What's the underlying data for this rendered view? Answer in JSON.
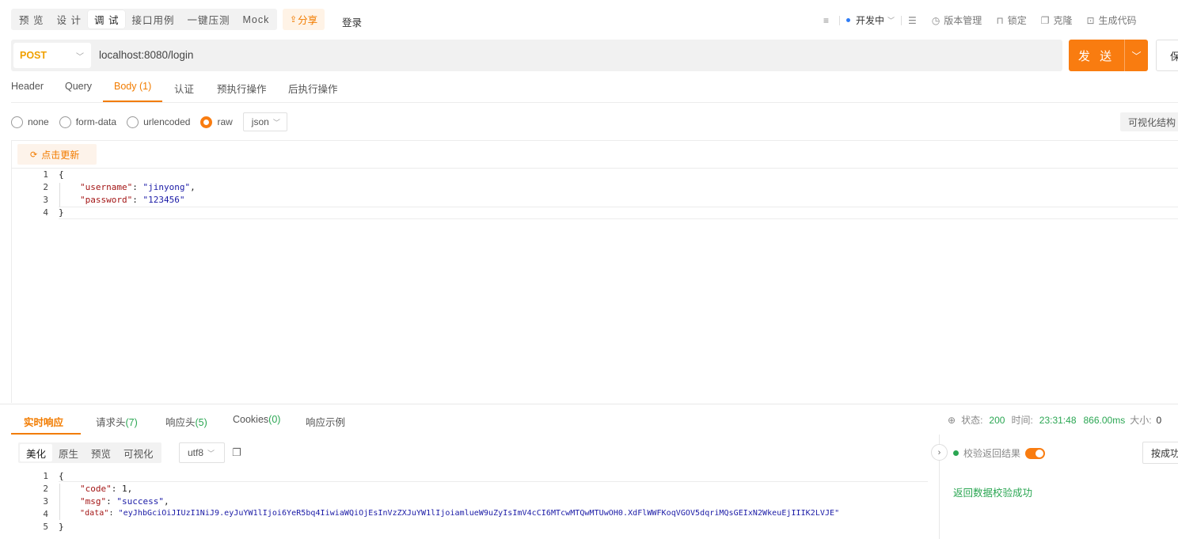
{
  "top": {
    "modes": [
      "预 览",
      "设 计",
      "调 试",
      "接口用例",
      "一键压测",
      "Mock"
    ],
    "active_mode": "调 试",
    "share": "分享",
    "login": "登录",
    "env": "开发中",
    "version": "版本管理",
    "lock": "锁定",
    "clone": "克隆",
    "gencode": "生成代码"
  },
  "request": {
    "method": "POST",
    "url": "localhost:8080/login",
    "send": "发 送",
    "save": "保"
  },
  "req_tabs": [
    {
      "label": "Header",
      "count": ""
    },
    {
      "label": "Query",
      "count": ""
    },
    {
      "label": "Body",
      "count": "(1)"
    },
    {
      "label": "认证",
      "count": ""
    },
    {
      "label": "预执行操作",
      "count": ""
    },
    {
      "label": "后执行操作",
      "count": ""
    }
  ],
  "body_types": [
    "none",
    "form-data",
    "urlencoded",
    "raw"
  ],
  "selected_body_type": "raw",
  "raw_format": "json",
  "visualize": "可视化结构",
  "refresh": "点击更新",
  "request_body": {
    "line_numbers": [
      "1",
      "2",
      "3",
      "4"
    ],
    "open": "{",
    "username_key": "\"username\"",
    "username_val": "\"jinyong\"",
    "password_key": "\"password\"",
    "password_val": "\"123456\"",
    "close": "}"
  },
  "resp_tabs": [
    {
      "label": "实时响应",
      "count": ""
    },
    {
      "label": "请求头",
      "count": "(7)"
    },
    {
      "label": "响应头",
      "count": "(5)"
    },
    {
      "label": "Cookies",
      "count": "(0)"
    },
    {
      "label": "响应示例",
      "count": ""
    }
  ],
  "status": {
    "status_label": "状态:",
    "status_code": "200",
    "time_label": "时间:",
    "time": "23:31:48",
    "duration": "866.00ms",
    "size_label": "大小:",
    "size": "0"
  },
  "response_formats": [
    "美化",
    "原生",
    "预览",
    "可视化"
  ],
  "active_format": "美化",
  "encoding": "utf8",
  "validate": {
    "label": "校验返回结果",
    "enabled": true,
    "by_feature": "按成功",
    "message": "返回数据校验成功"
  },
  "response_body": {
    "line_numbers": [
      "1",
      "2",
      "3",
      "4",
      "5"
    ],
    "open": "{",
    "code_key": "\"code\"",
    "code_val": "1",
    "msg_key": "\"msg\"",
    "msg_val": "\"success\"",
    "data_key": "\"data\"",
    "data_val": "\"eyJhbGciOiJIUzI1NiJ9.eyJuYW1lIjoi6YeR5bq4IiwiaWQiOjEsInVzZXJuYW1lIjoiamlueW9uZyIsImV4cCI6MTcwMTQwMTUwOH0.XdFlWWFKoqVGOV5dqriMQsGEIxN2WkeuEjIIIK2LVJE\"",
    "close": "}"
  },
  "colors": {
    "accent": "#f97c10",
    "success": "#2aa652",
    "json_key": "#a31515",
    "json_string": "#1a1aa6"
  }
}
